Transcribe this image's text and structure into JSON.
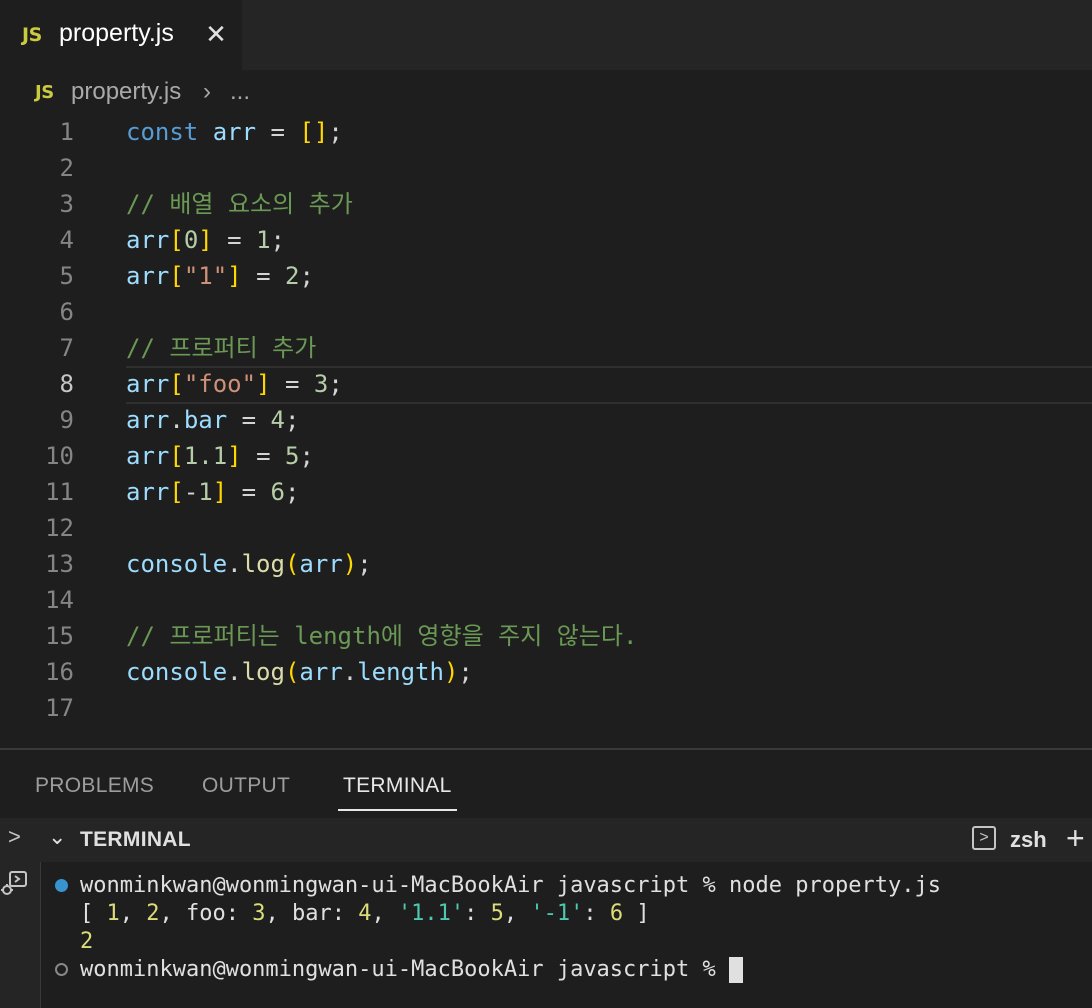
{
  "tab": {
    "badge": "JS",
    "filename": "property.js",
    "close_glyph": "✕"
  },
  "breadcrumb": {
    "badge": "JS",
    "file": "property.js",
    "separator": "›",
    "more": "..."
  },
  "editor": {
    "current_line": 8,
    "line_numbers": [
      "1",
      "2",
      "3",
      "4",
      "5",
      "6",
      "7",
      "8",
      "9",
      "10",
      "11",
      "12",
      "13",
      "14",
      "15",
      "16",
      "17"
    ],
    "comments": {
      "c3": "// 배열 요소의 추가",
      "c7": "// 프로퍼티 추가",
      "c15": "// 프로퍼티는 length에 영향을 주지 않는다."
    }
  },
  "panel": {
    "tabs": [
      "PROBLEMS",
      "OUTPUT",
      "TERMINAL"
    ],
    "active_tab": "TERMINAL",
    "header_title": "TERMINAL",
    "shell": "zsh",
    "add_glyph": "+"
  },
  "terminal": {
    "prompt": "wonminkwan@wonmingwan-ui-MacBookAir javascript % ",
    "command": "node property.js",
    "output_2": "2"
  },
  "colors": {
    "accent_js": "#cbcb41",
    "status_dot": "#3794cf",
    "editor_bg": "#1e1e1e"
  }
}
